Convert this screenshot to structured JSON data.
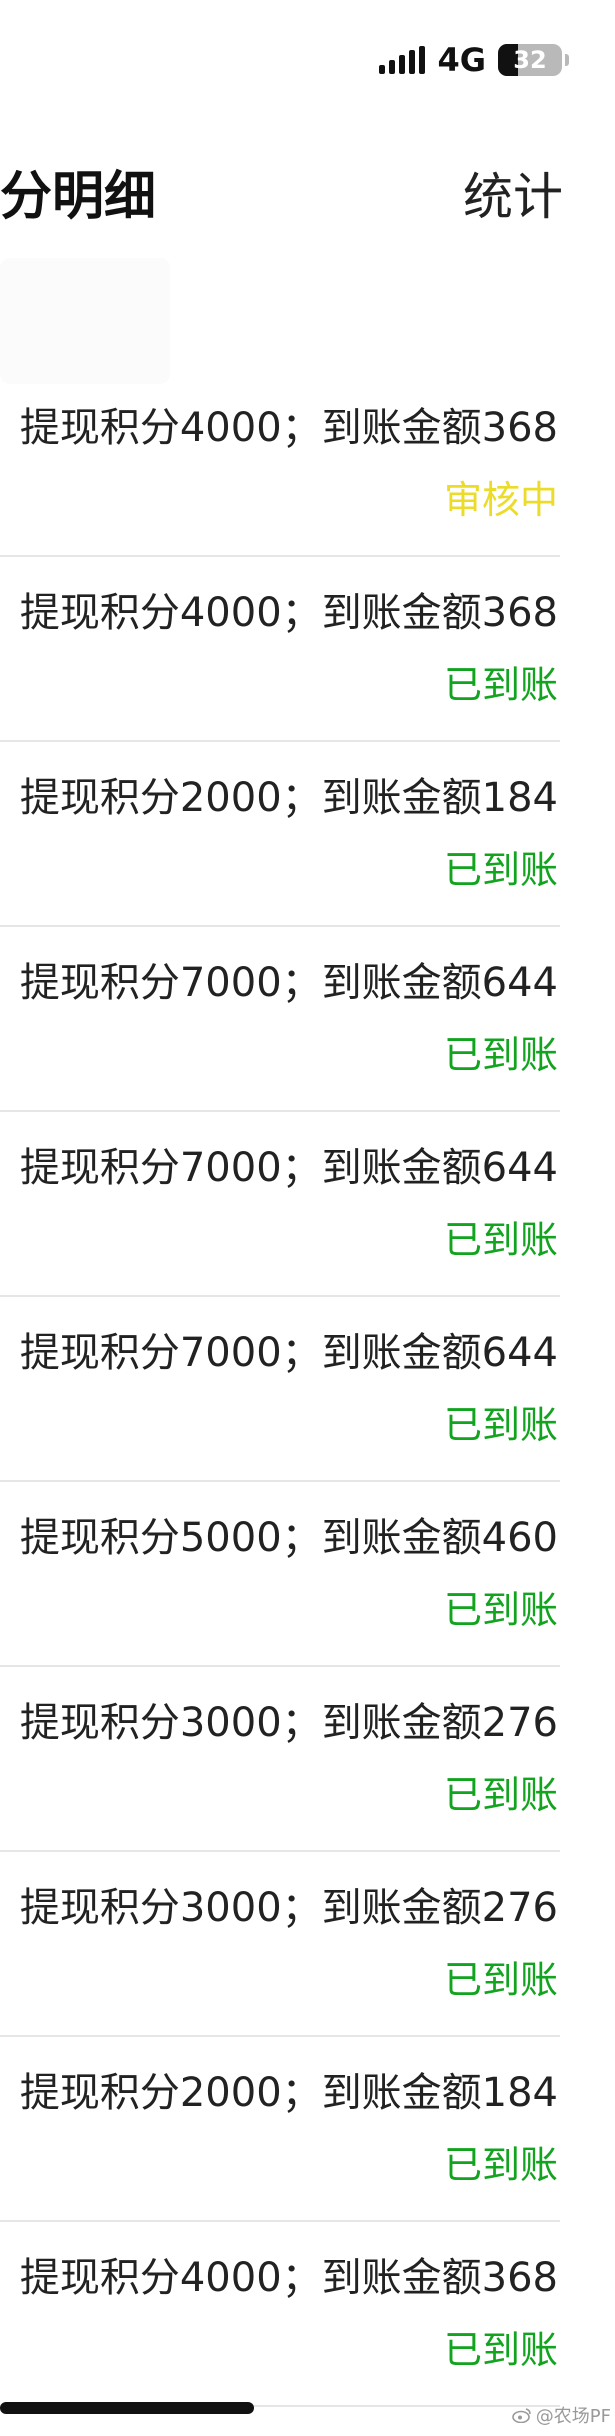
{
  "status_bar": {
    "network": "4G",
    "battery_level": "32",
    "battery_fraction": 0.32,
    "signal_icon": "cellular-signal-icon",
    "battery_icon": "battery-icon"
  },
  "nav": {
    "title": "分明细",
    "action": "统计"
  },
  "colors": {
    "pending": "#ecdc2a",
    "done": "#12a31f",
    "divider": "#e6e6e6"
  },
  "records": [
    {
      "text": "提现积分4000；到账金额368",
      "status": "审核中",
      "state": "pending"
    },
    {
      "text": "提现积分4000；到账金额368",
      "status": "已到账",
      "state": "done"
    },
    {
      "text": "提现积分2000；到账金额184",
      "status": "已到账",
      "state": "done"
    },
    {
      "text": "提现积分7000；到账金额644",
      "status": "已到账",
      "state": "done"
    },
    {
      "text": "提现积分7000；到账金额644",
      "status": "已到账",
      "state": "done"
    },
    {
      "text": "提现积分7000；到账金额644",
      "status": "已到账",
      "state": "done"
    },
    {
      "text": "提现积分5000；到账金额460",
      "status": "已到账",
      "state": "done"
    },
    {
      "text": "提现积分3000；到账金额276",
      "status": "已到账",
      "state": "done"
    },
    {
      "text": "提现积分3000；到账金额276",
      "status": "已到账",
      "state": "done"
    },
    {
      "text": "提现积分2000；到账金额184",
      "status": "已到账",
      "state": "done"
    },
    {
      "text": "提现积分4000；到账金额368",
      "status": "已到账",
      "state": "done"
    }
  ],
  "watermark": {
    "text": "@农场PF",
    "icon": "weibo-icon"
  }
}
